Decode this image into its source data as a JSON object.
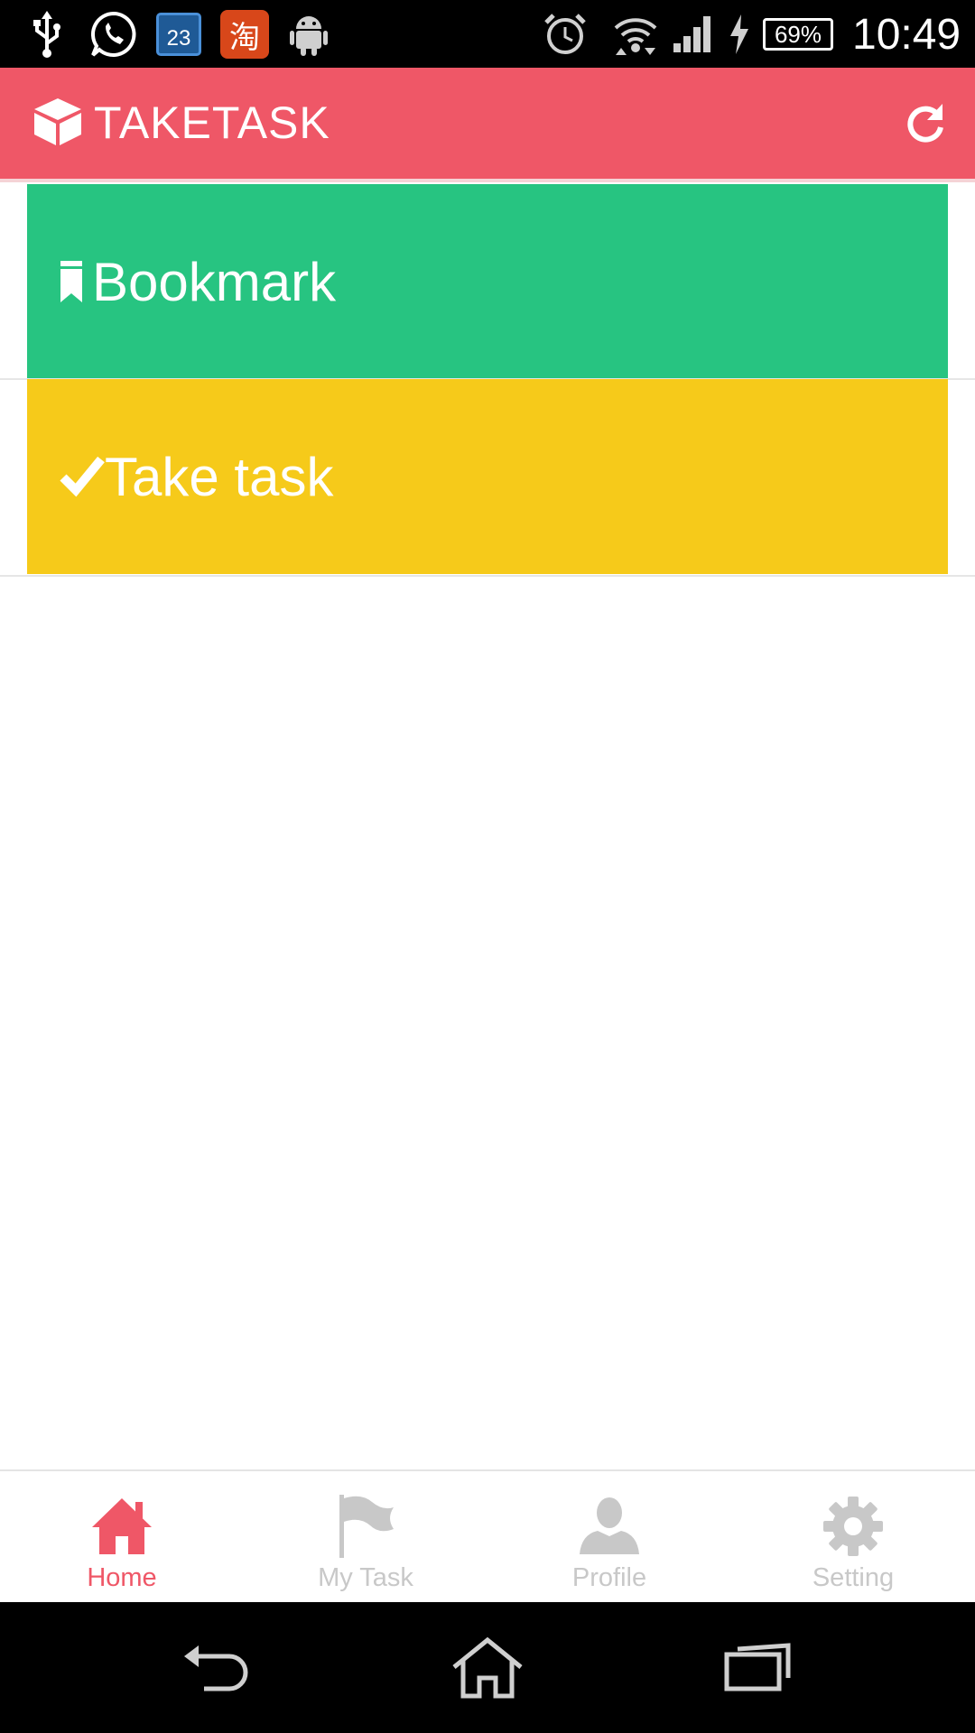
{
  "status_bar": {
    "time": "10:49",
    "battery": "69%",
    "calendar_day": "23",
    "taobao_char": "淘",
    "icons": [
      "usb-icon",
      "whatsapp-icon",
      "calendar-icon",
      "taobao-icon",
      "android-icon",
      "alarm-icon",
      "wifi-icon",
      "signal-icon",
      "charging-icon",
      "battery-icon"
    ]
  },
  "header": {
    "title": "TAKETASK",
    "logo_icon": "cube-icon",
    "action_icon": "refresh-icon",
    "background": "#ef5767"
  },
  "cards": [
    {
      "label": "Bookmark",
      "icon": "bookmark-icon",
      "color": "#27c481"
    },
    {
      "label": "Take task",
      "icon": "check-icon",
      "color": "#f6ca1a"
    }
  ],
  "bottom_nav": {
    "active": "Home",
    "items": [
      {
        "label": "Home",
        "icon": "home-icon"
      },
      {
        "label": "My Task",
        "icon": "flag-icon"
      },
      {
        "label": "Profile",
        "icon": "person-icon"
      },
      {
        "label": "Setting",
        "icon": "gear-icon"
      }
    ],
    "active_color": "#ef5767",
    "inactive_color": "#c8c8c8"
  },
  "system_nav": {
    "icons": [
      "back-icon",
      "home-outline-icon",
      "recents-icon"
    ]
  }
}
